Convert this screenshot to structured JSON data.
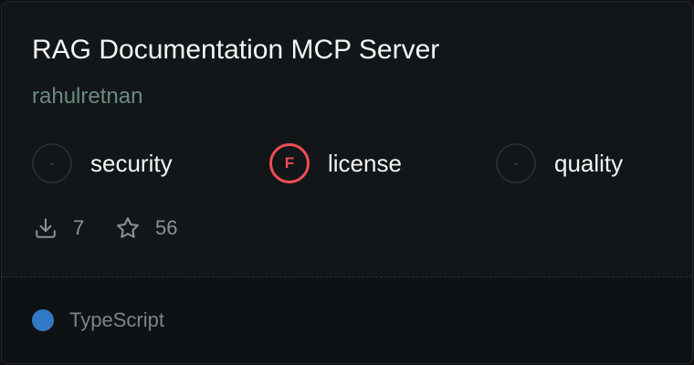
{
  "server": {
    "title": "RAG Documentation MCP Server",
    "author": "rahulretnan"
  },
  "scores": [
    {
      "grade": "-",
      "label": "security",
      "status": "none"
    },
    {
      "grade": "F",
      "label": "license",
      "status": "fail",
      "color": "#ec4e55"
    },
    {
      "grade": "-",
      "label": "quality",
      "status": "none"
    }
  ],
  "stats": {
    "downloads_icon": "download-icon",
    "downloads": "7",
    "stars_icon": "star-icon",
    "stars": "56"
  },
  "language": {
    "name": "TypeScript",
    "color": "#3178c6"
  }
}
